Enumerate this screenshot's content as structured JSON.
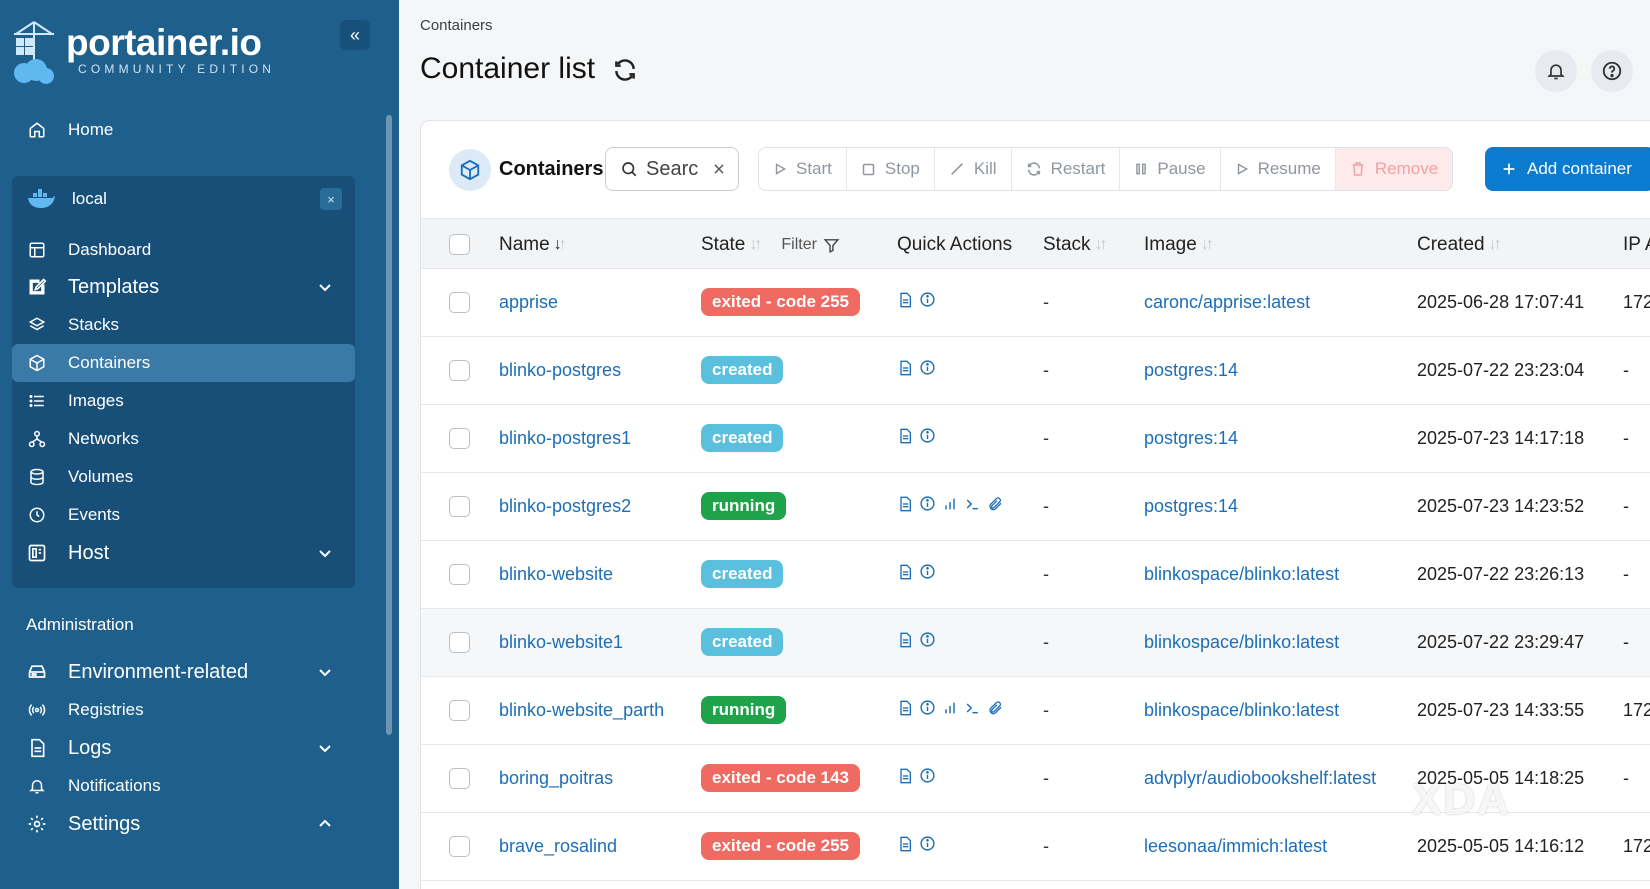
{
  "brand": {
    "name": "portainer.io",
    "edition": "COMMUNITY EDITION"
  },
  "sidebar": {
    "collapse_label": "«",
    "home": "Home",
    "environment": {
      "name": "local",
      "close": "×"
    },
    "env_items": [
      {
        "label": "Dashboard",
        "icon": "dashboard-icon"
      },
      {
        "label": "Templates",
        "icon": "templates-icon",
        "expandable": true
      },
      {
        "label": "Stacks",
        "icon": "stacks-icon"
      },
      {
        "label": "Containers",
        "icon": "cube-icon",
        "active": true
      },
      {
        "label": "Images",
        "icon": "list-icon"
      },
      {
        "label": "Networks",
        "icon": "network-icon"
      },
      {
        "label": "Volumes",
        "icon": "database-icon"
      },
      {
        "label": "Events",
        "icon": "clock-icon"
      },
      {
        "label": "Host",
        "icon": "host-icon",
        "expandable": true
      }
    ],
    "admin_title": "Administration",
    "admin_items": [
      {
        "label": "Environment-related",
        "icon": "drive-icon",
        "expandable": true
      },
      {
        "label": "Registries",
        "icon": "radio-icon"
      },
      {
        "label": "Logs",
        "icon": "file-icon",
        "expandable": true
      },
      {
        "label": "Notifications",
        "icon": "bell-icon"
      },
      {
        "label": "Settings",
        "icon": "gear-icon",
        "expandable": true,
        "expanded": true
      }
    ]
  },
  "header": {
    "breadcrumb": "Containers",
    "title": "Container list"
  },
  "toolbar": {
    "title": "Containers",
    "search_placeholder": "Searc",
    "buttons": {
      "start": "Start",
      "stop": "Stop",
      "kill": "Kill",
      "restart": "Restart",
      "pause": "Pause",
      "resume": "Resume",
      "remove": "Remove"
    },
    "add": "Add container"
  },
  "table": {
    "columns": {
      "name": "Name",
      "state": "State",
      "filter": "Filter",
      "quick_actions": "Quick Actions",
      "stack": "Stack",
      "image": "Image",
      "created": "Created",
      "ip": "IP A"
    },
    "rows": [
      {
        "name": "apprise",
        "state": "exited - code 255",
        "status": "exited",
        "full_actions": false,
        "stack": "-",
        "image": "caronc/apprise:latest",
        "created": "2025-06-28 17:07:41",
        "ip": "172"
      },
      {
        "name": "blinko-postgres",
        "state": "created",
        "status": "created",
        "full_actions": false,
        "stack": "-",
        "image": "postgres:14",
        "created": "2025-07-22 23:23:04",
        "ip": "-"
      },
      {
        "name": "blinko-postgres1",
        "state": "created",
        "status": "created",
        "full_actions": false,
        "stack": "-",
        "image": "postgres:14",
        "created": "2025-07-23 14:17:18",
        "ip": "-"
      },
      {
        "name": "blinko-postgres2",
        "state": "running",
        "status": "running",
        "full_actions": true,
        "stack": "-",
        "image": "postgres:14",
        "created": "2025-07-23 14:23:52",
        "ip": "-"
      },
      {
        "name": "blinko-website",
        "state": "created",
        "status": "created",
        "full_actions": false,
        "stack": "-",
        "image": "blinkospace/blinko:latest",
        "created": "2025-07-22 23:26:13",
        "ip": "-"
      },
      {
        "name": "blinko-website1",
        "state": "created",
        "status": "created",
        "full_actions": false,
        "stack": "-",
        "image": "blinkospace/blinko:latest",
        "created": "2025-07-22 23:29:47",
        "ip": "-"
      },
      {
        "name": "blinko-website_parth",
        "state": "running",
        "status": "running",
        "full_actions": true,
        "stack": "-",
        "image": "blinkospace/blinko:latest",
        "created": "2025-07-23 14:33:55",
        "ip": "172"
      },
      {
        "name": "boring_poitras",
        "state": "exited - code 143",
        "status": "exited",
        "full_actions": false,
        "stack": "-",
        "image": "advplyr/audiobookshelf:latest",
        "created": "2025-05-05 14:18:25",
        "ip": "-"
      },
      {
        "name": "brave_rosalind",
        "state": "exited - code 255",
        "status": "exited",
        "full_actions": false,
        "stack": "-",
        "image": "leesonaa/immich:latest",
        "created": "2025-05-05 14:16:12",
        "ip": "172"
      }
    ]
  },
  "watermark": "XDA",
  "colors": {
    "sidebar": "#1e5f8c",
    "primary": "#0b7bd0",
    "exited": "#ef6a61",
    "created": "#5bc0de",
    "running": "#1fa34a"
  }
}
